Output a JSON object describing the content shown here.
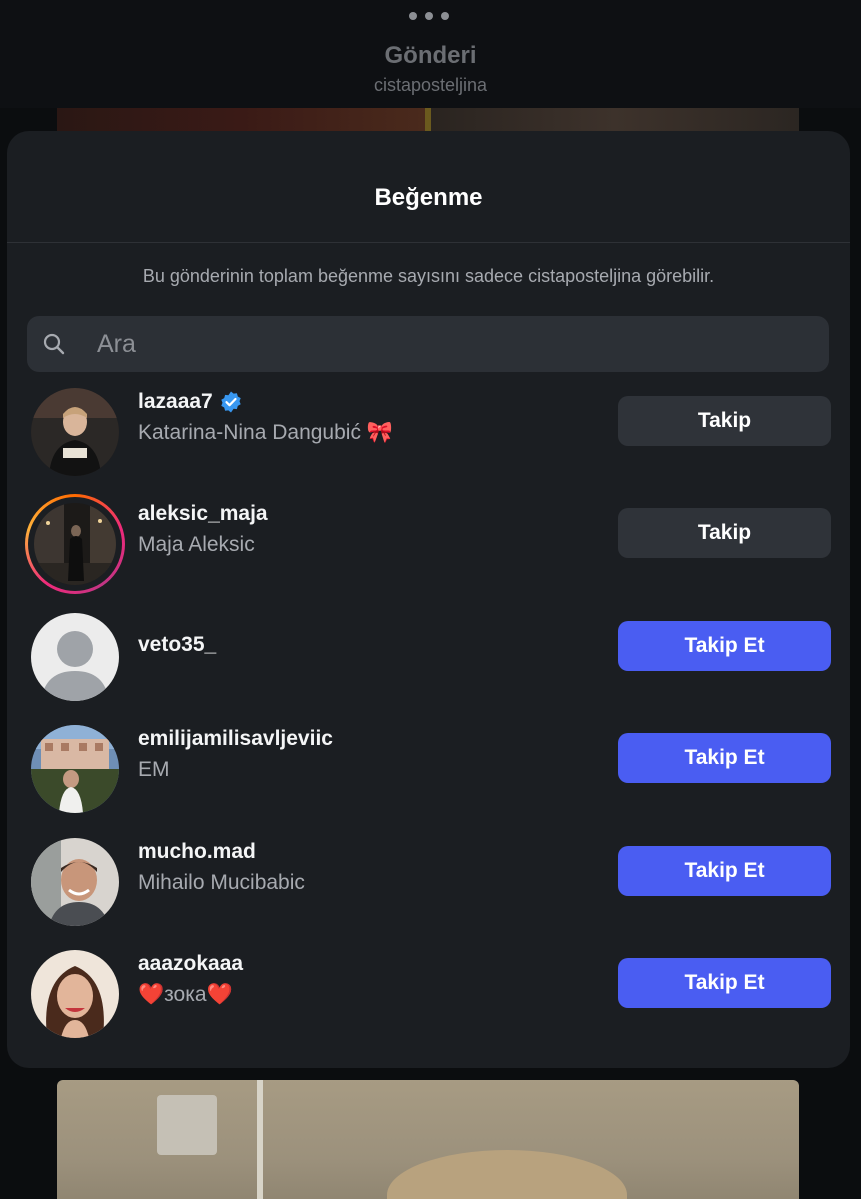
{
  "header": {
    "title": "Gönderi",
    "subtitle": "cistaposteljina",
    "more_icon": "more-dots-icon"
  },
  "likes_sheet": {
    "title": "Beğenme",
    "note": "Bu gönderinin toplam beğenme sayısını sadece cistaposteljina görebilir.",
    "search": {
      "placeholder": "Ara",
      "value": "",
      "icon": "search-icon"
    },
    "users": [
      {
        "username": "lazaaa7",
        "verified": true,
        "display_name": "Katarina-Nina Dangubić 🎀",
        "button": "Takip",
        "button_style": "secondary",
        "story_ring": false
      },
      {
        "username": "aleksic_maja",
        "verified": false,
        "display_name": "Maja Aleksic",
        "button": "Takip",
        "button_style": "secondary",
        "story_ring": true
      },
      {
        "username": "veto35_",
        "verified": false,
        "display_name": "",
        "button": "Takip Et",
        "button_style": "primary",
        "story_ring": false
      },
      {
        "username": "emilijamilisavljeviic",
        "verified": false,
        "display_name": "EM",
        "button": "Takip Et",
        "button_style": "primary",
        "story_ring": false
      },
      {
        "username": "mucho.mad",
        "verified": false,
        "display_name": "Mihailo Mucibabic",
        "button": "Takip Et",
        "button_style": "primary",
        "story_ring": false
      },
      {
        "username": "aaazokaaa",
        "verified": false,
        "display_name": "❤️зока❤️",
        "button": "Takip Et",
        "button_style": "primary",
        "story_ring": false
      }
    ]
  },
  "colors": {
    "primary_button": "#4a5df2",
    "secondary_button": "#2f3339",
    "sheet_background": "#1b1e22",
    "verified_badge": "#3897f0"
  }
}
